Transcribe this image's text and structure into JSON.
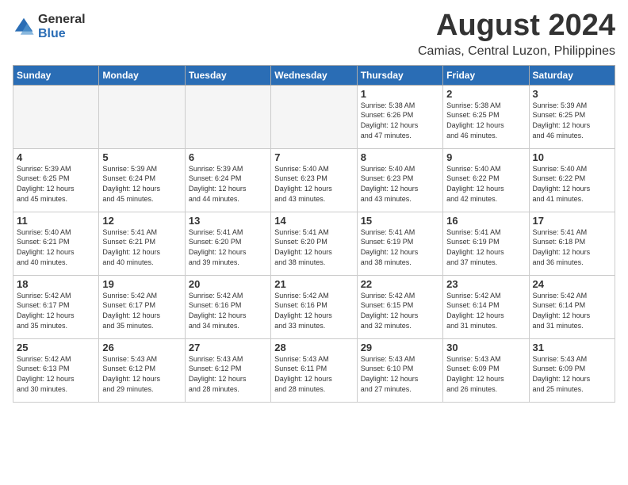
{
  "header": {
    "logo_general": "General",
    "logo_blue": "Blue",
    "main_title": "August 2024",
    "subtitle": "Camias, Central Luzon, Philippines"
  },
  "weekdays": [
    "Sunday",
    "Monday",
    "Tuesday",
    "Wednesday",
    "Thursday",
    "Friday",
    "Saturday"
  ],
  "weeks": [
    [
      {
        "day": "",
        "info": ""
      },
      {
        "day": "",
        "info": ""
      },
      {
        "day": "",
        "info": ""
      },
      {
        "day": "",
        "info": ""
      },
      {
        "day": "1",
        "info": "Sunrise: 5:38 AM\nSunset: 6:26 PM\nDaylight: 12 hours\nand 47 minutes."
      },
      {
        "day": "2",
        "info": "Sunrise: 5:38 AM\nSunset: 6:25 PM\nDaylight: 12 hours\nand 46 minutes."
      },
      {
        "day": "3",
        "info": "Sunrise: 5:39 AM\nSunset: 6:25 PM\nDaylight: 12 hours\nand 46 minutes."
      }
    ],
    [
      {
        "day": "4",
        "info": "Sunrise: 5:39 AM\nSunset: 6:25 PM\nDaylight: 12 hours\nand 45 minutes."
      },
      {
        "day": "5",
        "info": "Sunrise: 5:39 AM\nSunset: 6:24 PM\nDaylight: 12 hours\nand 45 minutes."
      },
      {
        "day": "6",
        "info": "Sunrise: 5:39 AM\nSunset: 6:24 PM\nDaylight: 12 hours\nand 44 minutes."
      },
      {
        "day": "7",
        "info": "Sunrise: 5:40 AM\nSunset: 6:23 PM\nDaylight: 12 hours\nand 43 minutes."
      },
      {
        "day": "8",
        "info": "Sunrise: 5:40 AM\nSunset: 6:23 PM\nDaylight: 12 hours\nand 43 minutes."
      },
      {
        "day": "9",
        "info": "Sunrise: 5:40 AM\nSunset: 6:22 PM\nDaylight: 12 hours\nand 42 minutes."
      },
      {
        "day": "10",
        "info": "Sunrise: 5:40 AM\nSunset: 6:22 PM\nDaylight: 12 hours\nand 41 minutes."
      }
    ],
    [
      {
        "day": "11",
        "info": "Sunrise: 5:40 AM\nSunset: 6:21 PM\nDaylight: 12 hours\nand 40 minutes."
      },
      {
        "day": "12",
        "info": "Sunrise: 5:41 AM\nSunset: 6:21 PM\nDaylight: 12 hours\nand 40 minutes."
      },
      {
        "day": "13",
        "info": "Sunrise: 5:41 AM\nSunset: 6:20 PM\nDaylight: 12 hours\nand 39 minutes."
      },
      {
        "day": "14",
        "info": "Sunrise: 5:41 AM\nSunset: 6:20 PM\nDaylight: 12 hours\nand 38 minutes."
      },
      {
        "day": "15",
        "info": "Sunrise: 5:41 AM\nSunset: 6:19 PM\nDaylight: 12 hours\nand 38 minutes."
      },
      {
        "day": "16",
        "info": "Sunrise: 5:41 AM\nSunset: 6:19 PM\nDaylight: 12 hours\nand 37 minutes."
      },
      {
        "day": "17",
        "info": "Sunrise: 5:41 AM\nSunset: 6:18 PM\nDaylight: 12 hours\nand 36 minutes."
      }
    ],
    [
      {
        "day": "18",
        "info": "Sunrise: 5:42 AM\nSunset: 6:17 PM\nDaylight: 12 hours\nand 35 minutes."
      },
      {
        "day": "19",
        "info": "Sunrise: 5:42 AM\nSunset: 6:17 PM\nDaylight: 12 hours\nand 35 minutes."
      },
      {
        "day": "20",
        "info": "Sunrise: 5:42 AM\nSunset: 6:16 PM\nDaylight: 12 hours\nand 34 minutes."
      },
      {
        "day": "21",
        "info": "Sunrise: 5:42 AM\nSunset: 6:16 PM\nDaylight: 12 hours\nand 33 minutes."
      },
      {
        "day": "22",
        "info": "Sunrise: 5:42 AM\nSunset: 6:15 PM\nDaylight: 12 hours\nand 32 minutes."
      },
      {
        "day": "23",
        "info": "Sunrise: 5:42 AM\nSunset: 6:14 PM\nDaylight: 12 hours\nand 31 minutes."
      },
      {
        "day": "24",
        "info": "Sunrise: 5:42 AM\nSunset: 6:14 PM\nDaylight: 12 hours\nand 31 minutes."
      }
    ],
    [
      {
        "day": "25",
        "info": "Sunrise: 5:42 AM\nSunset: 6:13 PM\nDaylight: 12 hours\nand 30 minutes."
      },
      {
        "day": "26",
        "info": "Sunrise: 5:43 AM\nSunset: 6:12 PM\nDaylight: 12 hours\nand 29 minutes."
      },
      {
        "day": "27",
        "info": "Sunrise: 5:43 AM\nSunset: 6:12 PM\nDaylight: 12 hours\nand 28 minutes."
      },
      {
        "day": "28",
        "info": "Sunrise: 5:43 AM\nSunset: 6:11 PM\nDaylight: 12 hours\nand 28 minutes."
      },
      {
        "day": "29",
        "info": "Sunrise: 5:43 AM\nSunset: 6:10 PM\nDaylight: 12 hours\nand 27 minutes."
      },
      {
        "day": "30",
        "info": "Sunrise: 5:43 AM\nSunset: 6:09 PM\nDaylight: 12 hours\nand 26 minutes."
      },
      {
        "day": "31",
        "info": "Sunrise: 5:43 AM\nSunset: 6:09 PM\nDaylight: 12 hours\nand 25 minutes."
      }
    ]
  ]
}
